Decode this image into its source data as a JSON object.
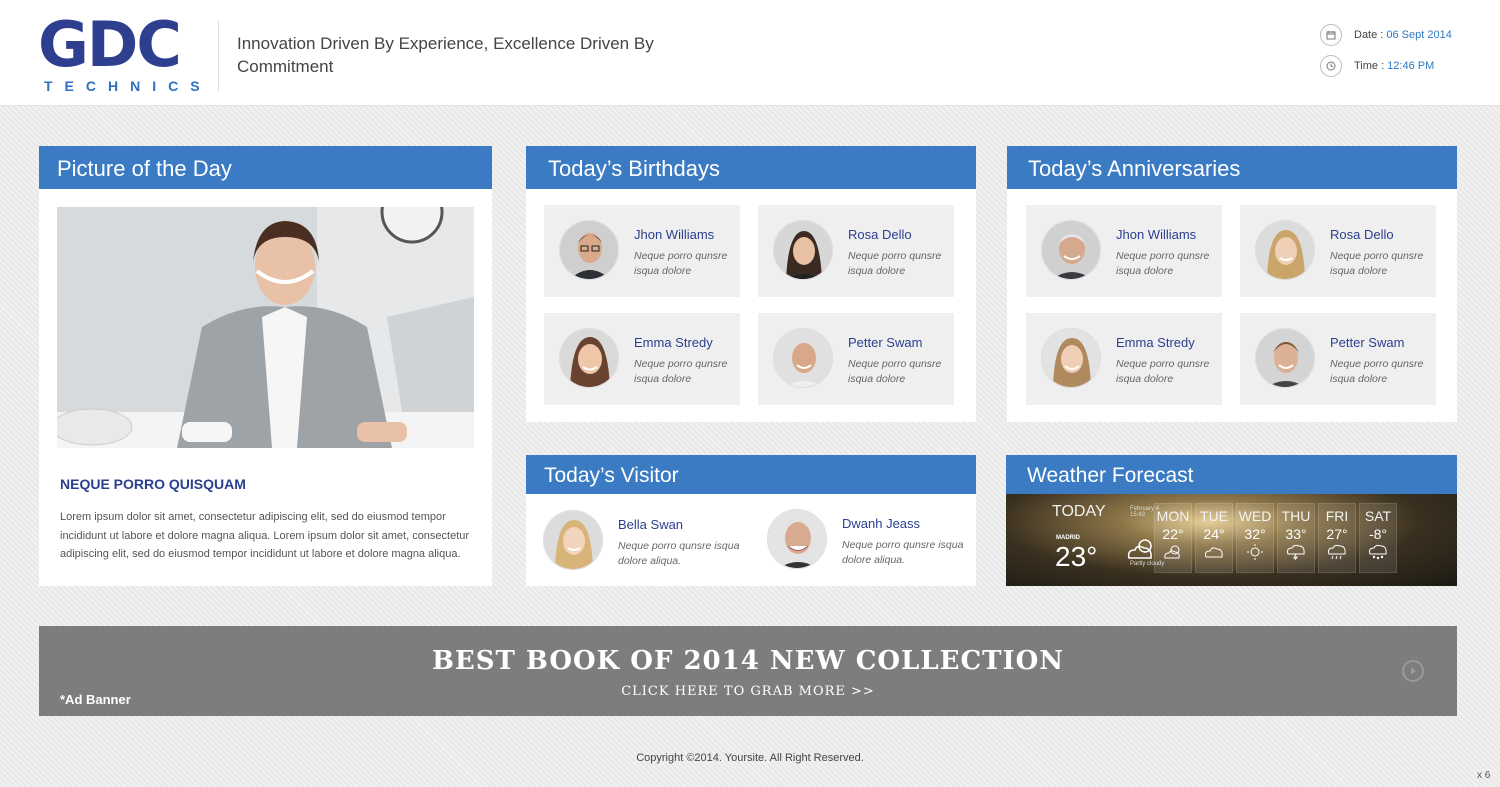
{
  "header": {
    "logo_main": "GDC",
    "logo_sub": "TECHNICS",
    "tagline": "Innovation Driven By Experience, Excellence Driven By Commitment",
    "date_label": "Date :",
    "date_value": "06 Sept 2014",
    "time_label": "Time :",
    "time_value": "12:46 PM"
  },
  "picture_of_day": {
    "title": "Picture of the Day",
    "heading": "NEQUE PORRO QUISQUAM",
    "text": "Lorem ipsum dolor sit amet, consectetur adipiscing elit, sed do eiusmod tempor incididunt ut labore et dolore magna aliqua. Lorem ipsum dolor sit amet, consectetur adipiscing elit, sed do eiusmod tempor incididunt ut labore et dolore magna aliqua."
  },
  "birthdays": {
    "title": "Today’s Birthdays",
    "people": [
      {
        "name": "Jhon Williams",
        "desc": "Neque porro qunsre isqua dolore"
      },
      {
        "name": "Rosa Dello",
        "desc": "Neque porro qunsre isqua dolore"
      },
      {
        "name": "Emma Stredy",
        "desc": "Neque porro qunsre isqua dolore"
      },
      {
        "name": "Petter Swam",
        "desc": "Neque porro qunsre isqua dolore"
      }
    ]
  },
  "anniversaries": {
    "title": "Today’s Anniversaries",
    "people": [
      {
        "name": "Jhon Williams",
        "desc": "Neque porro qunsre isqua dolore"
      },
      {
        "name": "Rosa Dello",
        "desc": "Neque porro qunsre isqua dolore"
      },
      {
        "name": "Emma Stredy",
        "desc": "Neque porro qunsre isqua dolore"
      },
      {
        "name": "Petter Swam",
        "desc": "Neque porro qunsre isqua dolore"
      }
    ]
  },
  "visitor": {
    "title": "Today’s Visitor",
    "people": [
      {
        "name": "Bella Swan",
        "desc": "Neque porro qunsre isqua dolore aliqua."
      },
      {
        "name": "Dwanh Jeass",
        "desc": "Neque porro qunsre isqua dolore aliqua."
      }
    ]
  },
  "weather": {
    "title": "Weather Forecast",
    "today_label": "TODAY",
    "today_date": "February 4 15:43",
    "city": "MADRID",
    "today_temp": "23°",
    "today_condition": "Partly cloudy",
    "days": [
      {
        "name": "MON",
        "temp": "22°",
        "icon": "sun-cloud-icon"
      },
      {
        "name": "TUE",
        "temp": "24°",
        "icon": "cloud-icon"
      },
      {
        "name": "WED",
        "temp": "32°",
        "icon": "sun-icon"
      },
      {
        "name": "THU",
        "temp": "33°",
        "icon": "storm-icon"
      },
      {
        "name": "FRI",
        "temp": "27°",
        "icon": "rain-icon"
      },
      {
        "name": "SAT",
        "temp": "-8°",
        "icon": "snow-icon"
      }
    ]
  },
  "ad": {
    "title": "BEST BOOK OF 2014 NEW COLLECTION",
    "cta": "CLICK HERE TO GRAB MORE >>",
    "label": "*Ad Banner"
  },
  "footer": {
    "copyright": "Copyright ©2014. Yoursite. All Right Reserved.",
    "corner": "x 6"
  }
}
